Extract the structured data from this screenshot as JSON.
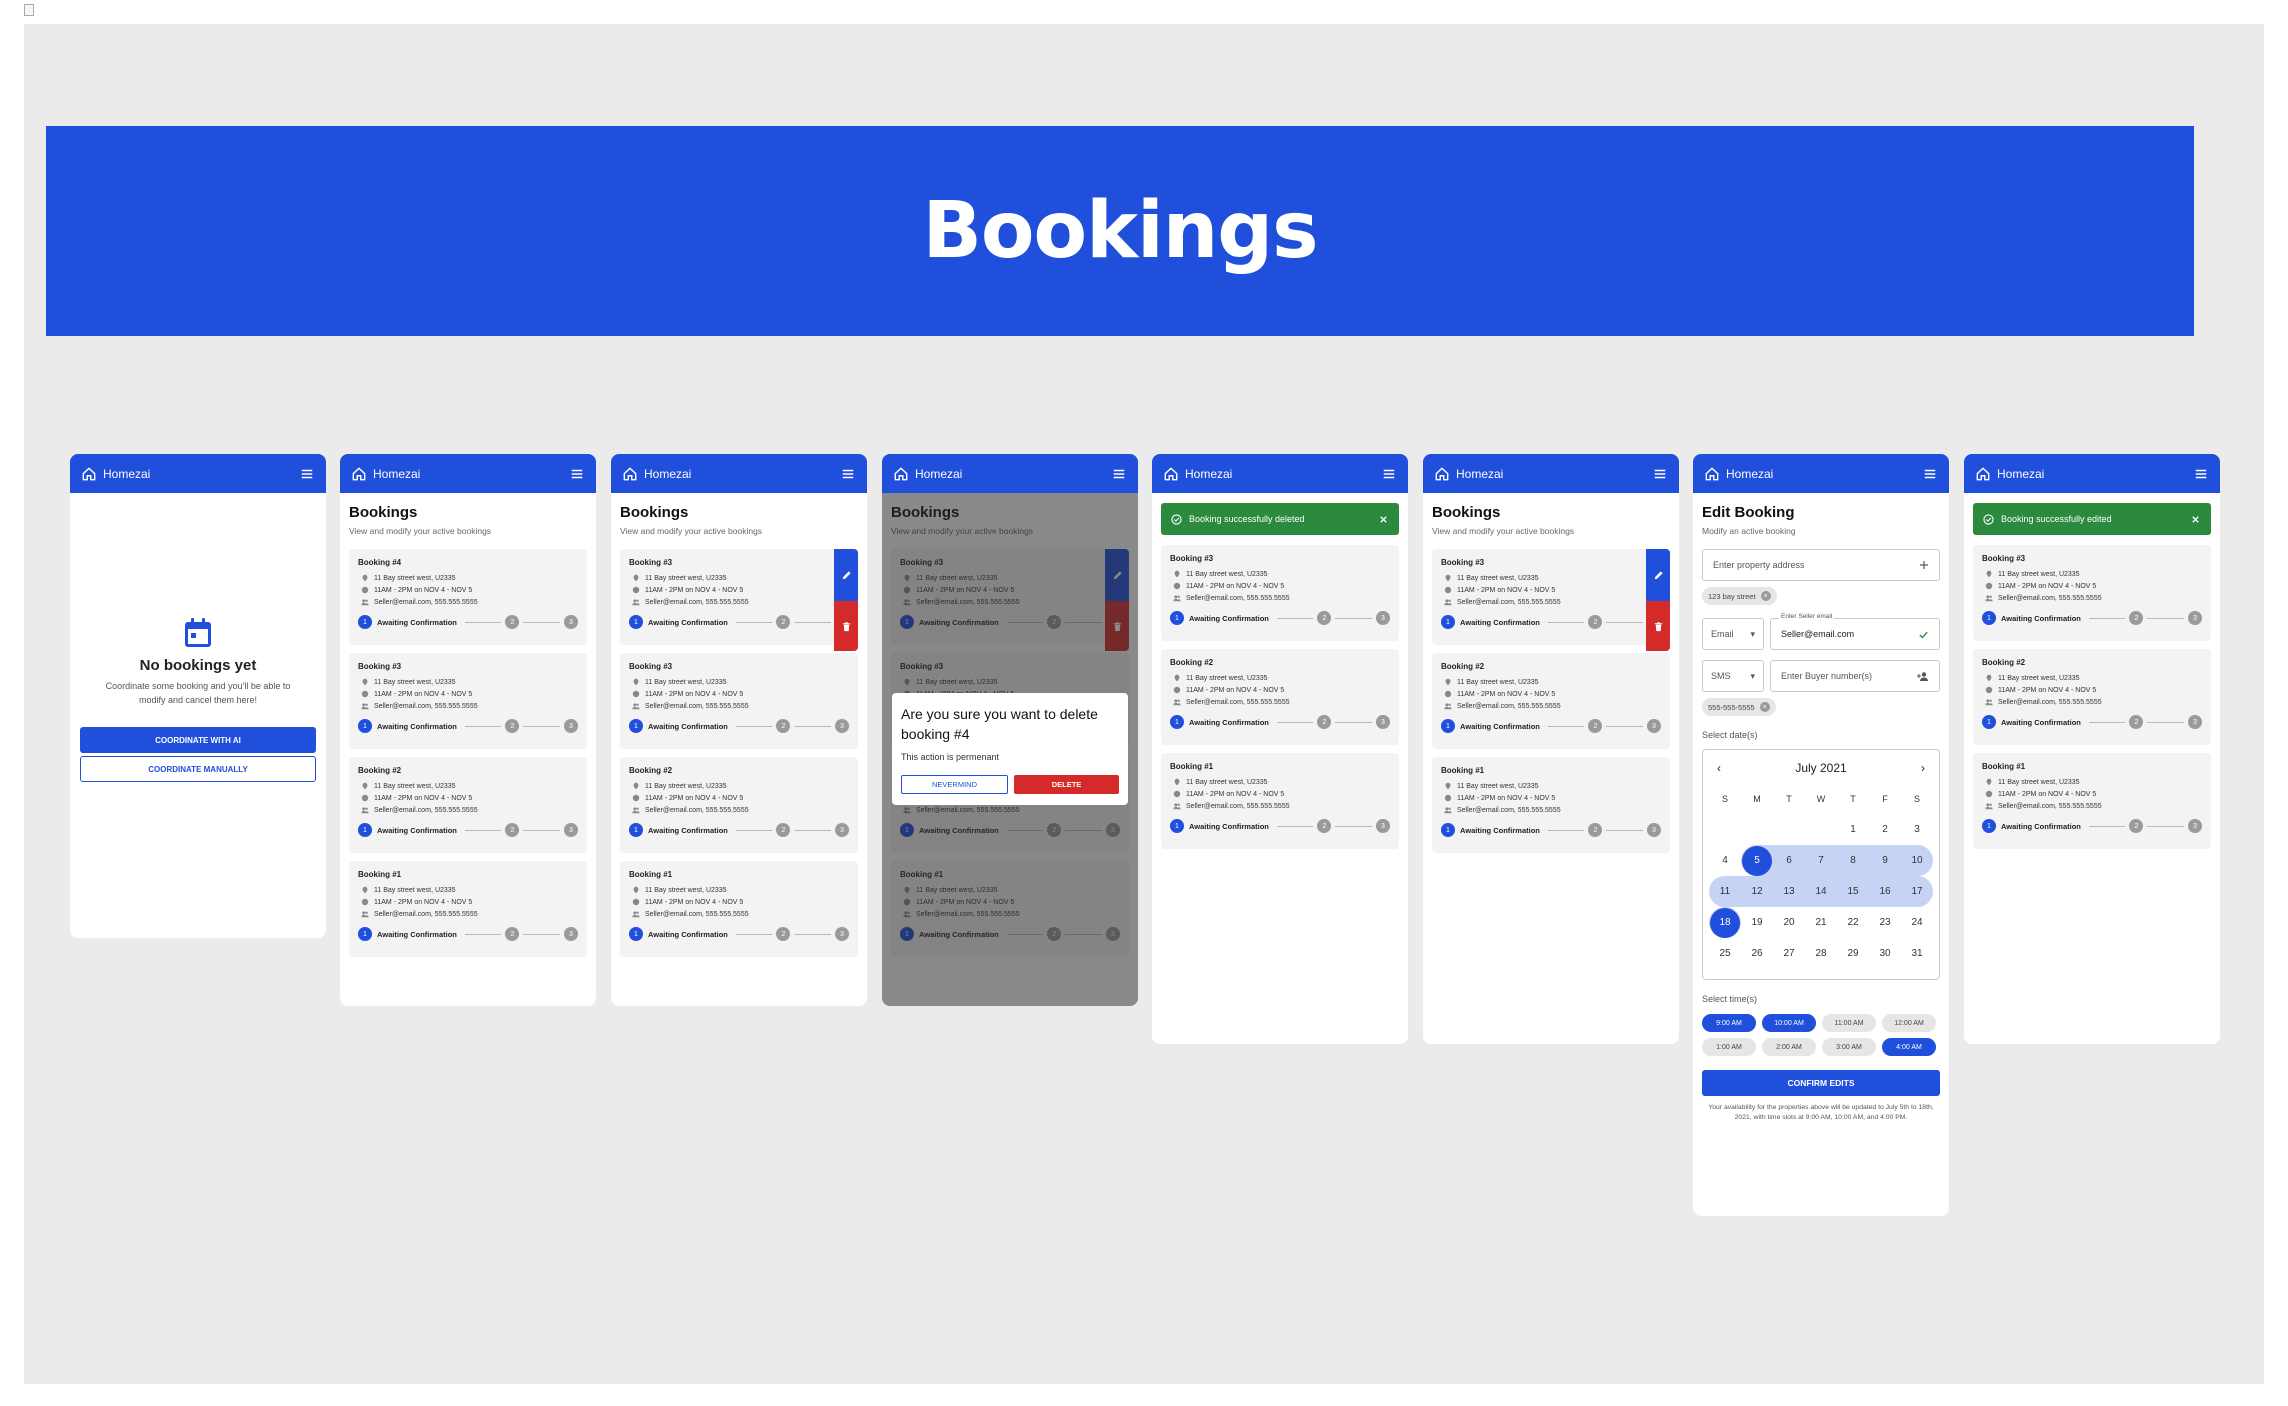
{
  "banner_title": "Bookings",
  "brand": "Homezai",
  "colors": {
    "primary": "#1f4fdb",
    "danger": "#d42a2a",
    "success": "#2b8a3e",
    "background": "#ebebeb"
  },
  "bookings_title": "Bookings",
  "bookings_subtitle": "View and modify your active bookings",
  "address": "11 Bay street west, U2335",
  "time_range": "11AM - 2PM on NOV 4 - NOV 5",
  "contact": "Seller@email.com, 555.555.5555",
  "status": "Awaiting Confirmation",
  "step_labels": [
    "1",
    "2",
    "3"
  ],
  "booking_names": {
    "b4": "Booking #4",
    "b3": "Booking #3",
    "b2": "Booking #2",
    "b1": "Booking #1"
  },
  "empty_state": {
    "icon": "calendar-icon",
    "title": "No bookings yet",
    "subtitle_line1": "Coordinate some booking and you'll be able to",
    "subtitle_line2": "modify and cancel them here!",
    "ai_button": "COORDINATE WITH AI",
    "manual_button": "COORDINATE MANUALLY"
  },
  "delete_dialog": {
    "question": "Are you sure you want to delete booking #4",
    "note": "This action is permenant",
    "cancel": "NEVERMIND",
    "confirm": "DELETE"
  },
  "toast_deleted": "Booking successfully deleted",
  "toast_edited": "Booking successfully edited",
  "edit": {
    "title": "Edit Booking",
    "subtitle": "Modify an active booking",
    "address_placeholder": "Enter property address",
    "address_chip": "123 bay street",
    "contact_type": "Email",
    "seller_label": "Enter Seller email",
    "seller_value": "Seller@email.com",
    "sms_type": "SMS",
    "buyer_placeholder": "Enter Buyer number(s)",
    "phone_chip": "555-555-5555",
    "dates_label": "Select date(s)",
    "month": "July 2021",
    "weekdays": [
      "S",
      "M",
      "T",
      "W",
      "T",
      "F",
      "S"
    ],
    "range_start": 5,
    "range_end": 18,
    "days_in_month": 31,
    "first_weekday": 4,
    "times_label": "Select time(s)",
    "times": [
      {
        "label": "9:00 AM",
        "selected": true
      },
      {
        "label": "10:00 AM",
        "selected": true
      },
      {
        "label": "11:00 AM",
        "selected": false
      },
      {
        "label": "12:00 AM",
        "selected": false
      },
      {
        "label": "1:00 AM",
        "selected": false
      },
      {
        "label": "2:00 AM",
        "selected": false
      },
      {
        "label": "3:00 AM",
        "selected": false
      },
      {
        "label": "4:00 AM",
        "selected": true
      }
    ],
    "confirm_button": "CONFIRM EDITS",
    "note": "Your availability for the properties above will be updated to July 5th to 18th, 2021, with time slots at 9:00 AM, 10:00 AM, and 4:00 PM."
  }
}
